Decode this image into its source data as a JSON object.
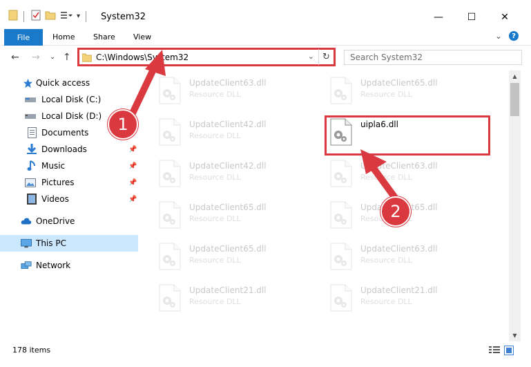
{
  "window": {
    "title": "System32",
    "minimize_glyph": "—",
    "maximize_glyph": "☐",
    "close_glyph": "✕"
  },
  "ribbon": {
    "tabs": [
      "File",
      "Home",
      "Share",
      "View"
    ],
    "expand_glyph": "⌄",
    "help_glyph": "?"
  },
  "nav": {
    "back_glyph": "←",
    "forward_glyph": "→",
    "recent_glyph": "⌄",
    "up_glyph": "↑",
    "address_path": "C:\\Windows\\System32",
    "address_dropdown_glyph": "⌄",
    "refresh_glyph": "↻",
    "search_placeholder": "Search System32"
  },
  "sidebar": {
    "items": [
      {
        "label": "Quick access",
        "icon": "star-icon",
        "pinned": false
      },
      {
        "label": "Local Disk (C:)",
        "icon": "drive-icon",
        "pinned": false
      },
      {
        "label": "Local Disk (D:)",
        "icon": "drive-icon",
        "pinned": false
      },
      {
        "label": "Documents",
        "icon": "documents-icon",
        "pinned": true
      },
      {
        "label": "Downloads",
        "icon": "downloads-icon",
        "pinned": true
      },
      {
        "label": "Music",
        "icon": "music-icon",
        "pinned": true
      },
      {
        "label": "Pictures",
        "icon": "pictures-icon",
        "pinned": true
      },
      {
        "label": "Videos",
        "icon": "videos-icon",
        "pinned": true
      },
      {
        "label": "OneDrive",
        "icon": "onedrive-icon",
        "pinned": false
      },
      {
        "label": "This PC",
        "icon": "pc-icon",
        "pinned": false,
        "selected": true
      },
      {
        "label": "Network",
        "icon": "network-icon",
        "pinned": false
      }
    ],
    "pin_glyph": "📌"
  },
  "files": {
    "left_column": [
      {
        "name": "UpdateClient63.dll",
        "type": "Resource DLL"
      },
      {
        "name": "UpdateClient42.dll",
        "type": "Resource DLL"
      },
      {
        "name": "UpdateClient42.dll",
        "type": "Resource DLL"
      },
      {
        "name": "UpdateClient65.dll",
        "type": "Resource DLL"
      },
      {
        "name": "UpdateClient65.dll",
        "type": "Resource DLL"
      },
      {
        "name": "UpdateClient21.dll",
        "type": "Resource DLL"
      }
    ],
    "right_column": [
      {
        "name": "UpdateClient65.dll",
        "type": "Resource DLL"
      },
      {
        "name": "uipla6.dll",
        "type": "",
        "highlighted": true
      },
      {
        "name": "UpdateClient63.dll",
        "type": "Resource DLL"
      },
      {
        "name": "UpdateClient65.dll",
        "type": "Resource DLL"
      },
      {
        "name": "UpdateClient63.dll",
        "type": "Resource DLL"
      },
      {
        "name": "UpdateClient21.dll",
        "type": "Resource DLL"
      }
    ]
  },
  "status": {
    "item_count": "178 items"
  },
  "annotations": {
    "step1": "1",
    "step2": "2",
    "color": "#d9393f"
  },
  "colors": {
    "accent": "#1979ca",
    "highlight_red": "#d9393f",
    "selected_bg": "#cce8ff"
  }
}
